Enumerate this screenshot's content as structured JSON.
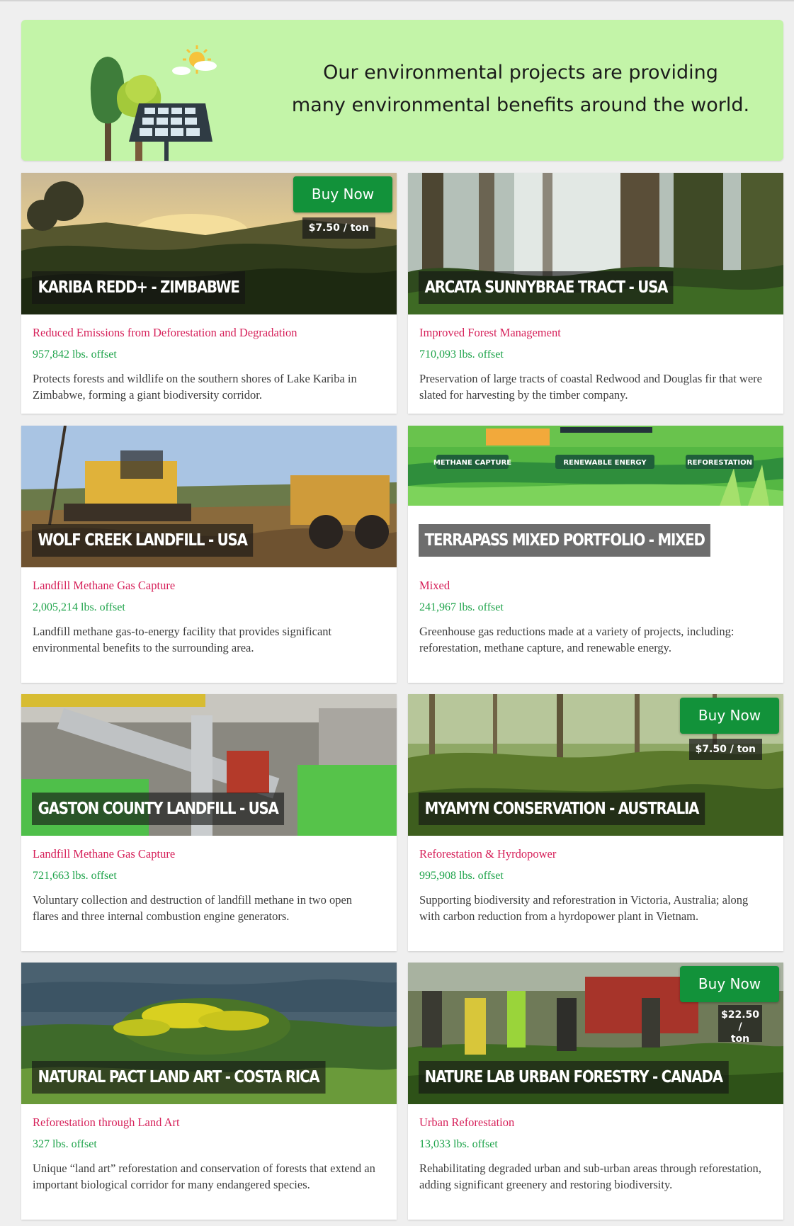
{
  "banner": {
    "line1": "Our environmental projects are providing",
    "line2": "many environmental benefits around the world."
  },
  "colors": {
    "banner_bg": "#c3f4a8",
    "buy_button": "#12923a",
    "category": "#d6215a",
    "offset": "#1ea34a"
  },
  "projects": [
    {
      "title": "KARIBA REDD+ - ZIMBABWE",
      "category": "Reduced Emissions from Deforestation and Degradation",
      "offset": "957,842 lbs. offset",
      "description": "Protects forests and wildlife on the southern shores of Lake Kariba in Zimbabwe, forming a giant biodiversity corridor.",
      "buy_label": "Buy Now",
      "price": "$7.50 / ton"
    },
    {
      "title": "ARCATA SUNNYBRAE TRACT - USA",
      "category": "Improved Forest Management",
      "offset": "710,093 lbs. offset",
      "description": "Preservation of large tracts of coastal Redwood and Douglas fir that were slated for harvesting by the timber company."
    },
    {
      "title": "WOLF CREEK LANDFILL - USA",
      "category": "Landfill Methane Gas Capture",
      "offset": "2,005,214 lbs. offset",
      "description": "Landfill methane gas-to-energy facility that provides significant environmental benefits to the surrounding area."
    },
    {
      "title": "TERRAPASS MIXED PORTFOLIO - MIXED",
      "category": "Mixed",
      "offset": "241,967 lbs. offset",
      "description": "Greenhouse gas reductions made at a variety of projects, including: reforestation, methane capture, and renewable energy.",
      "labels": [
        "METHANE CAPTURE",
        "RENEWABLE ENERGY",
        "REFORESTATION"
      ]
    },
    {
      "title": "GASTON COUNTY LANDFILL - USA",
      "category": "Landfill Methane Gas Capture",
      "offset": "721,663 lbs. offset",
      "description": "Voluntary collection and destruction of landfill methane in two open flares and three internal combustion engine generators."
    },
    {
      "title": "MYAMYN CONSERVATION - AUSTRALIA",
      "category": "Reforestation & Hyrdopower",
      "offset": "995,908 lbs. offset",
      "description": "Supporting biodiversity and reforestration in Victoria, Australia; along with carbon reduction from a hyrdopower plant in Vietnam.",
      "buy_label": "Buy Now",
      "price": "$7.50 / ton"
    },
    {
      "title": "NATURAL PACT LAND ART - COSTA RICA",
      "category": "Reforestation through Land Art",
      "offset": "327 lbs. offset",
      "description": "Unique “land art” reforestation and conservation of forests that extend an important biological corridor for many endangered species."
    },
    {
      "title": "NATURE LAB URBAN FORESTRY - CANADA",
      "category": "Urban Reforestation",
      "offset": "13,033 lbs. offset",
      "description": "Rehabilitating degraded urban and sub-urban areas through reforestation, adding significant greenery and restoring biodiversity.",
      "buy_label": "Buy Now",
      "price_line1": "$22.50 /",
      "price_line2": "ton"
    }
  ]
}
